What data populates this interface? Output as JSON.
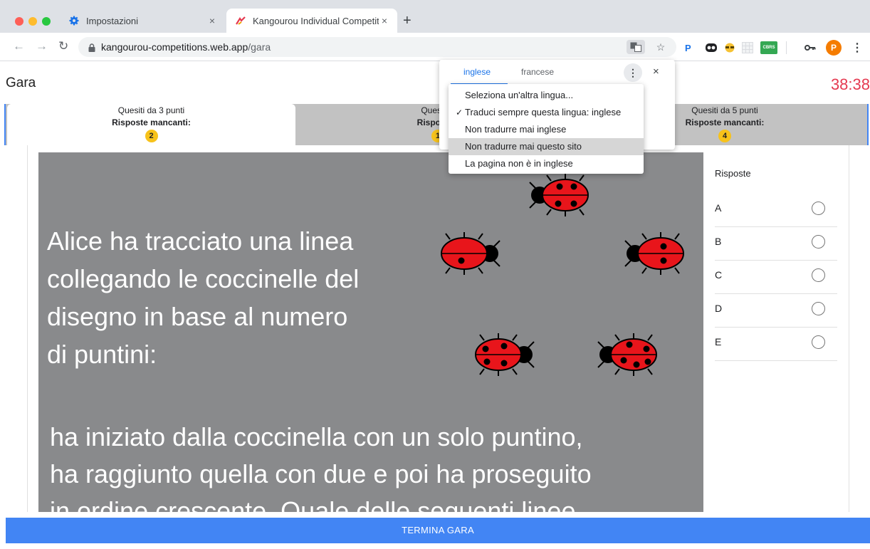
{
  "browser": {
    "tabs": [
      {
        "title": "Impostazioni",
        "icon": "gear-icon",
        "close": "×"
      },
      {
        "title": "Kangourou Individual Competit",
        "icon": "kangourou-logo-icon",
        "close": "×"
      }
    ],
    "new_tab": "+",
    "url": {
      "host": "kangourou-competitions.web.app",
      "path": "/gara"
    },
    "profile_initial": "P",
    "extensions": [
      {
        "name": "pinterest-extension-icon",
        "label": "P",
        "color": "#1a73e8"
      },
      {
        "name": "cbrs-extension-icon",
        "label": "CBRS",
        "color": "#34a853"
      }
    ]
  },
  "header": {
    "title": "Gara",
    "timer": "38:38"
  },
  "sections": [
    {
      "title": "Quesiti da 3 punti",
      "missing_label": "Risposte mancanti:",
      "missing_count": "2"
    },
    {
      "title": "Quesiti d",
      "missing_label": "Risposte r",
      "missing_count": "1"
    },
    {
      "title": "Quesiti da 5 punti",
      "missing_label": "Risposte mancanti:",
      "missing_count": "4"
    }
  ],
  "question": {
    "text_part1": "Alice ha tracciato una linea\ncollegando le coccinelle del\ndisegno in base al numero\ndi puntini:",
    "text_part2": "ha iniziato dalla coccinella con un solo puntino,\nha raggiunto quella con due e poi ha proseguito\nin ordine crescente. Quale delle seguenti linee"
  },
  "answers": {
    "title": "Risposte",
    "options": [
      "A",
      "B",
      "C",
      "D",
      "E"
    ]
  },
  "finish_button": "TERMINA GARA",
  "translate": {
    "tabs": [
      "inglese",
      "francese"
    ],
    "close": "×",
    "more": "⋮",
    "menu": [
      "Seleziona un'altra lingua...",
      "Traduci sempre questa lingua: inglese",
      "Non tradurre mai inglese",
      "Non tradurre mai questo sito",
      "La pagina non è in inglese"
    ]
  },
  "colors": {
    "accent": "#4285f4",
    "timer": "#e53950",
    "badge": "#f7c21a",
    "question_bg": "#898a8c",
    "ladybug": "#e8151b"
  }
}
